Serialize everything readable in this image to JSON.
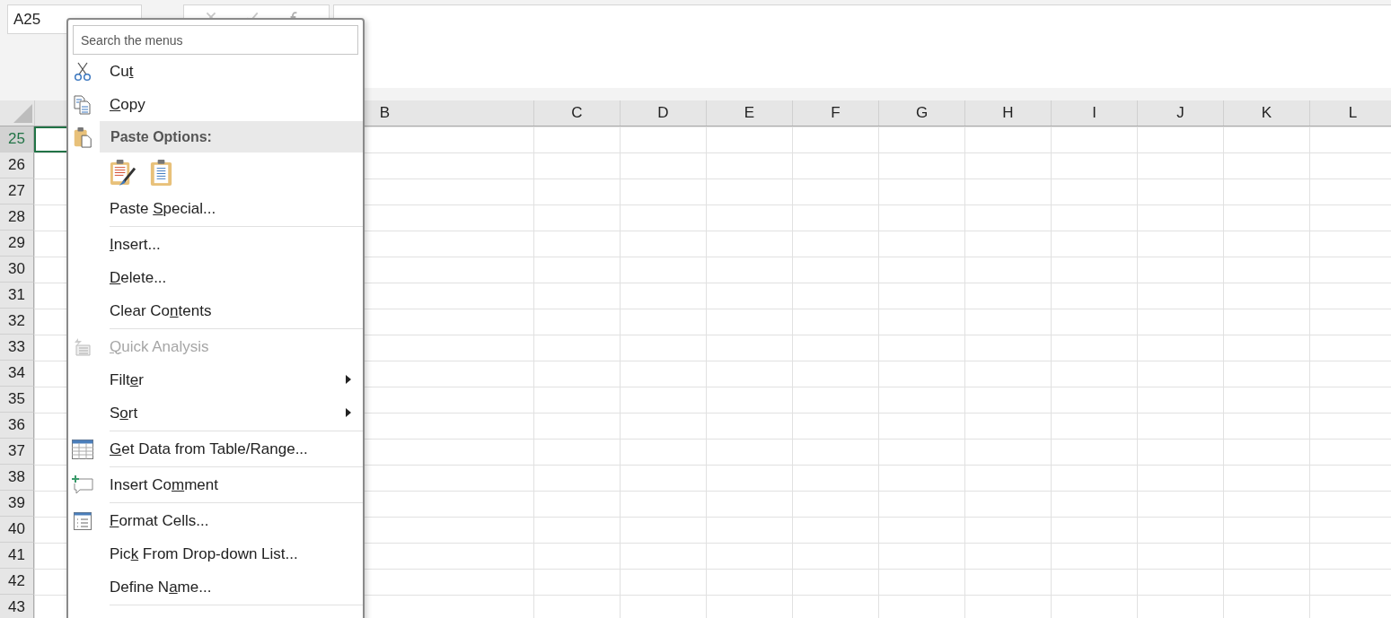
{
  "name_box": {
    "value": "A25"
  },
  "columns": [
    {
      "label": "B"
    },
    {
      "label": "C"
    },
    {
      "label": "D"
    },
    {
      "label": "E"
    },
    {
      "label": "F"
    },
    {
      "label": "G"
    },
    {
      "label": "H"
    },
    {
      "label": "I"
    },
    {
      "label": "J"
    },
    {
      "label": "K"
    },
    {
      "label": "L"
    }
  ],
  "rows": [
    {
      "label": "25",
      "selected": true
    },
    {
      "label": "26",
      "selected": false
    },
    {
      "label": "27",
      "selected": false
    },
    {
      "label": "28",
      "selected": false
    },
    {
      "label": "29",
      "selected": false
    },
    {
      "label": "30",
      "selected": false
    },
    {
      "label": "31",
      "selected": false
    },
    {
      "label": "32",
      "selected": false
    },
    {
      "label": "33",
      "selected": false
    },
    {
      "label": "34",
      "selected": false
    },
    {
      "label": "35",
      "selected": false
    },
    {
      "label": "36",
      "selected": false
    },
    {
      "label": "37",
      "selected": false
    },
    {
      "label": "38",
      "selected": false
    },
    {
      "label": "39",
      "selected": false
    },
    {
      "label": "40",
      "selected": false
    },
    {
      "label": "41",
      "selected": false
    },
    {
      "label": "42",
      "selected": false
    },
    {
      "label": "43",
      "selected": false
    }
  ],
  "context_menu": {
    "search": {
      "placeholder": "Search the menus"
    },
    "items": [
      {
        "kind": "command",
        "label": {
          "before": "Cu",
          "key": "t"
        },
        "disabled": false,
        "submenu": false,
        "separator_after": false
      },
      {
        "kind": "command",
        "label": {
          "key": "C",
          "after": "opy"
        },
        "disabled": false,
        "submenu": false,
        "separator_after": false
      },
      {
        "kind": "header",
        "text": "Paste Options:"
      },
      {
        "kind": "paste_icons"
      },
      {
        "kind": "command",
        "label": {
          "before": "Paste ",
          "key": "S",
          "after": "pecial..."
        },
        "disabled": false,
        "submenu": false,
        "separator_after": true
      },
      {
        "kind": "command",
        "label": {
          "key": "I",
          "after": "nsert..."
        },
        "disabled": false,
        "submenu": false,
        "separator_after": false
      },
      {
        "kind": "command",
        "label": {
          "key": "D",
          "after": "elete..."
        },
        "disabled": false,
        "submenu": false,
        "separator_after": false
      },
      {
        "kind": "command",
        "label": {
          "before": "Clear Co",
          "key": "n",
          "after": "tents"
        },
        "disabled": false,
        "submenu": false,
        "separator_after": true
      },
      {
        "kind": "command",
        "label": {
          "key": "Q",
          "after": "uick Analysis"
        },
        "disabled": true,
        "submenu": false,
        "separator_after": false
      },
      {
        "kind": "command",
        "label": {
          "before": "Filt",
          "key": "e",
          "after": "r"
        },
        "disabled": false,
        "submenu": true,
        "separator_after": false
      },
      {
        "kind": "command",
        "label": {
          "before": "S",
          "key": "o",
          "after": "rt"
        },
        "disabled": false,
        "submenu": true,
        "separator_after": true
      },
      {
        "kind": "command",
        "label": {
          "key": "G",
          "after": "et Data from Table/Range..."
        },
        "disabled": false,
        "submenu": false,
        "separator_after": true
      },
      {
        "kind": "command",
        "label": {
          "before": "Insert Co",
          "key": "m",
          "after": "ment"
        },
        "disabled": false,
        "submenu": false,
        "separator_after": true
      },
      {
        "kind": "command",
        "label": {
          "key": "F",
          "after": "ormat Cells..."
        },
        "disabled": false,
        "submenu": false,
        "separator_after": false
      },
      {
        "kind": "command",
        "label": {
          "before": "Pic",
          "key": "k",
          "after": " From Drop-down List..."
        },
        "disabled": false,
        "submenu": false,
        "separator_after": false
      },
      {
        "kind": "command",
        "label": {
          "before": "Define N",
          "key": "a",
          "after": "me..."
        },
        "disabled": false,
        "submenu": false,
        "separator_after": true
      }
    ]
  }
}
